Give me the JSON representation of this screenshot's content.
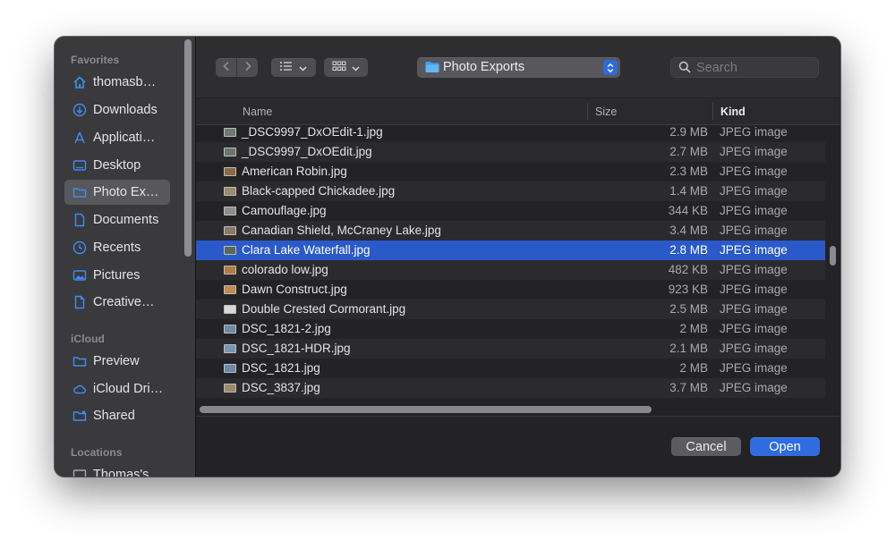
{
  "sidebar": {
    "sections": [
      {
        "heading": "Favorites",
        "items": [
          {
            "label": "thomasb…",
            "icon": "home-icon"
          },
          {
            "label": "Downloads",
            "icon": "download-icon"
          },
          {
            "label": "Applicati…",
            "icon": "applications-icon"
          },
          {
            "label": "Desktop",
            "icon": "desktop-icon"
          },
          {
            "label": "Photo Ex…",
            "icon": "folder-icon",
            "selected": true
          },
          {
            "label": "Documents",
            "icon": "document-icon"
          },
          {
            "label": "Recents",
            "icon": "clock-icon"
          },
          {
            "label": "Pictures",
            "icon": "photo-icon"
          },
          {
            "label": "Creative…",
            "icon": "file-icon"
          }
        ]
      },
      {
        "heading": "iCloud",
        "items": [
          {
            "label": "Preview",
            "icon": "folder-icon"
          },
          {
            "label": "iCloud Dri…",
            "icon": "cloud-icon"
          },
          {
            "label": "Shared",
            "icon": "shared-folder-icon"
          }
        ]
      },
      {
        "heading": "Locations",
        "items": [
          {
            "label": "Thomas's…",
            "icon": "computer-icon"
          }
        ]
      }
    ]
  },
  "toolbar": {
    "back_icon": "chevron-left-icon",
    "forward_icon": "chevron-right-icon",
    "list_view_icon": "list-icon",
    "grid_view_icon": "grid-icon",
    "location": "Photo Exports",
    "search_placeholder": "Search"
  },
  "columns": {
    "name": "Name",
    "size": "Size",
    "kind": "Kind"
  },
  "files": [
    {
      "name": "_DSC9997_DxOEdit-1.jpg",
      "size": "2.9 MB",
      "kind": "JPEG image",
      "thumb": "#6f7a6e"
    },
    {
      "name": "_DSC9997_DxOEdit.jpg",
      "size": "2.7 MB",
      "kind": "JPEG image",
      "thumb": "#6c776b"
    },
    {
      "name": "American Robin.jpg",
      "size": "2.3 MB",
      "kind": "JPEG image",
      "thumb": "#8c6a44"
    },
    {
      "name": "Black-capped Chickadee.jpg",
      "size": "1.4 MB",
      "kind": "JPEG image",
      "thumb": "#9c8a6a"
    },
    {
      "name": "Camouflage.jpg",
      "size": "344 KB",
      "kind": "JPEG image",
      "thumb": "#8a8f8c"
    },
    {
      "name": "Canadian Shield, McCraney Lake.jpg",
      "size": "3.4 MB",
      "kind": "JPEG image",
      "thumb": "#8d7a62"
    },
    {
      "name": "Clara Lake Waterfall.jpg",
      "size": "2.8 MB",
      "kind": "JPEG image",
      "thumb": "#5b6a58",
      "selected": true
    },
    {
      "name": "colorado low.jpg",
      "size": "482 KB",
      "kind": "JPEG image",
      "thumb": "#b07a45"
    },
    {
      "name": "Dawn Construct.jpg",
      "size": "923 KB",
      "kind": "JPEG image",
      "thumb": "#c08a50"
    },
    {
      "name": "Double Crested Cormorant.jpg",
      "size": "2.5 MB",
      "kind": "JPEG image",
      "thumb": "#d8d8d8"
    },
    {
      "name": "DSC_1821-2.jpg",
      "size": "2 MB",
      "kind": "JPEG image",
      "thumb": "#6e8aa8"
    },
    {
      "name": "DSC_1821-HDR.jpg",
      "size": "2.1 MB",
      "kind": "JPEG image",
      "thumb": "#7a95b0"
    },
    {
      "name": "DSC_1821.jpg",
      "size": "2 MB",
      "kind": "JPEG image",
      "thumb": "#6d89a6"
    },
    {
      "name": "DSC_3837.jpg",
      "size": "3.7 MB",
      "kind": "JPEG image",
      "thumb": "#9a8c6a"
    }
  ],
  "buttons": {
    "cancel": "Cancel",
    "open": "Open"
  },
  "colors": {
    "accent": "#2e6ce0",
    "selection": "#2a59c9"
  }
}
